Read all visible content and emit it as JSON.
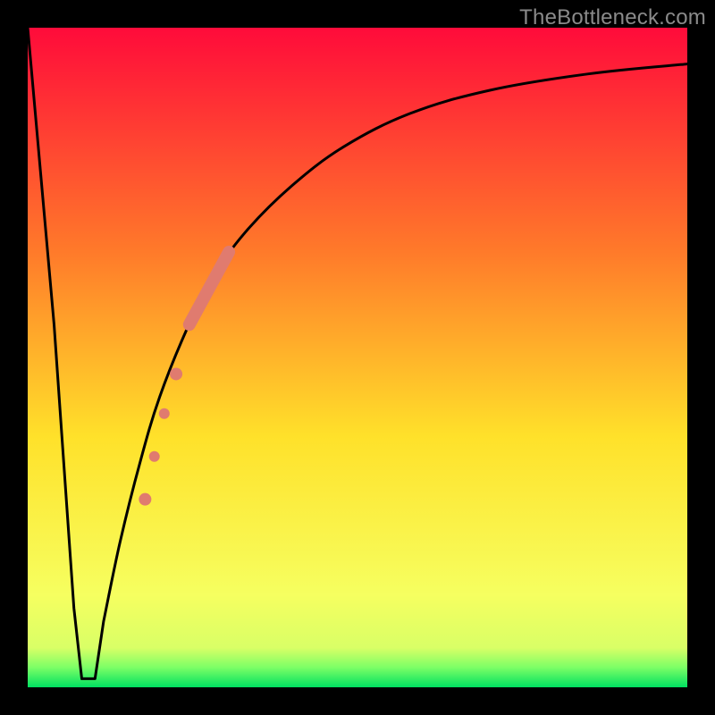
{
  "watermark": "TheBottleneck.com",
  "colors": {
    "gradient_top": "#ff0b3a",
    "gradient_mid_upper": "#ff7a2a",
    "gradient_mid": "#ffe12a",
    "gradient_lower": "#f6ff60",
    "gradient_green1": "#7cff66",
    "gradient_green2": "#00e061",
    "curve": "#000000",
    "marker": "#e07b6f"
  },
  "chart_data": {
    "type": "line",
    "title": "",
    "xlabel": "",
    "ylabel": "",
    "xlim": [
      0,
      100
    ],
    "ylim": [
      0,
      100
    ],
    "series": [
      {
        "name": "bottleneck-curve",
        "x": [
          0,
          4,
          7,
          8.5,
          10,
          11.5,
          14,
          17,
          20,
          24,
          28,
          33,
          40,
          48,
          58,
          70,
          85,
          100
        ],
        "y": [
          100,
          55,
          12,
          1.5,
          1.5,
          10,
          22,
          34,
          44,
          54,
          62,
          69,
          76,
          82,
          87,
          90.5,
          93,
          94.5
        ]
      }
    ],
    "flat_bottom": {
      "x_start": 8.2,
      "x_end": 10.2,
      "y": 1.3
    },
    "markers_thick_segment": {
      "x_start": 24.5,
      "y_start": 55,
      "x_end": 30.5,
      "y_end": 66,
      "width": 14
    },
    "markers_dots": [
      {
        "x": 22.5,
        "y": 47.5,
        "r": 7
      },
      {
        "x": 20.7,
        "y": 41.5,
        "r": 6
      },
      {
        "x": 19.2,
        "y": 35.0,
        "r": 6
      },
      {
        "x": 17.8,
        "y": 28.5,
        "r": 7
      }
    ]
  }
}
